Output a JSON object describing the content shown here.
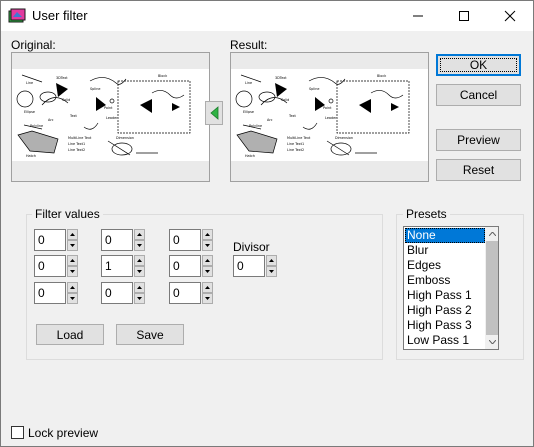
{
  "window": {
    "title": "User filter"
  },
  "titlebar": {
    "minimize_icon": "minimize-icon",
    "maximize_icon": "maximize-icon",
    "close_icon": "close-icon"
  },
  "previews": {
    "original_label": "Original:",
    "result_label": "Result:",
    "apply_arrow_icon": "arrow-left-icon",
    "drawing_texts": [
      "Line",
      "3DText",
      "Spline",
      "Block",
      "Ellipse",
      "Point",
      "Solid",
      "Text",
      "Arc",
      "Leader",
      "Polyline",
      "Dimension",
      "Hatch",
      "MultiLine Text",
      "Line Text1",
      "Line Text2"
    ]
  },
  "buttons": {
    "ok": "OK",
    "cancel": "Cancel",
    "preview": "Preview",
    "reset": "Reset",
    "load": "Load",
    "save": "Save"
  },
  "filter_values": {
    "title": "Filter values",
    "matrix": [
      [
        "0",
        "0",
        "0"
      ],
      [
        "0",
        "1",
        "0"
      ],
      [
        "0",
        "0",
        "0"
      ]
    ],
    "divisor_label": "Divisor",
    "divisor_value": "0"
  },
  "presets": {
    "title": "Presets",
    "items": [
      "None",
      "Blur",
      "Edges",
      "Emboss",
      "High Pass 1",
      "High Pass 2",
      "High Pass 3",
      "Low Pass 1"
    ],
    "selected": "None"
  },
  "lock_preview": {
    "label": "Lock preview",
    "checked": false
  },
  "colors": {
    "accent": "#0078d7",
    "arrow_green": "#2fb344",
    "face": "#f0f0f0"
  }
}
